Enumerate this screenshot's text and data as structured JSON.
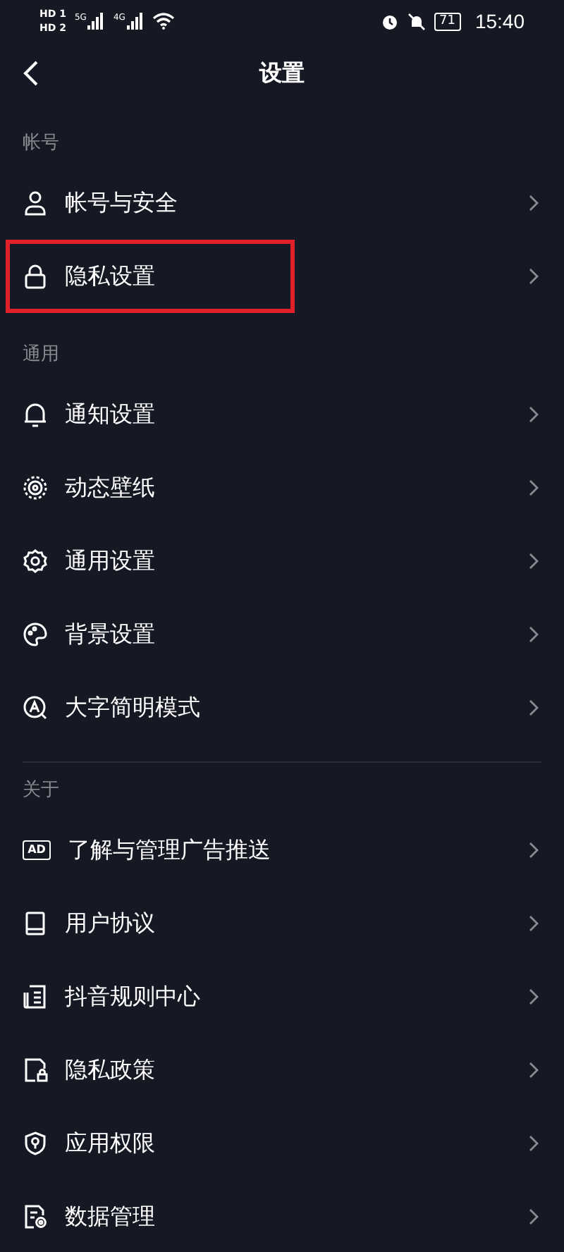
{
  "status_bar": {
    "sims": [
      {
        "label": "HD",
        "slot": "1"
      },
      {
        "label": "HD",
        "slot": "2"
      }
    ],
    "networks": [
      "5G",
      "4G"
    ],
    "battery": "71",
    "time": "15:40"
  },
  "header": {
    "title": "设置"
  },
  "sections": [
    {
      "title": "帐号",
      "divider": false,
      "items": [
        {
          "kind": "person",
          "label": "帐号与安全",
          "highlighted": false
        },
        {
          "kind": "lock",
          "label": "隐私设置",
          "highlighted": true
        }
      ]
    },
    {
      "title": "通用",
      "divider": false,
      "items": [
        {
          "kind": "bell",
          "label": "通知设置",
          "highlighted": false
        },
        {
          "kind": "wallpaper",
          "label": "动态壁纸",
          "highlighted": false
        },
        {
          "kind": "gear",
          "label": "通用设置",
          "highlighted": false
        },
        {
          "kind": "palette",
          "label": "背景设置",
          "highlighted": false
        },
        {
          "kind": "bigtext",
          "label": "大字简明模式",
          "highlighted": false
        }
      ]
    },
    {
      "title": "关于",
      "divider": true,
      "items": [
        {
          "kind": "ad",
          "icon_text": "AD",
          "label": "了解与管理广告推送",
          "highlighted": false
        },
        {
          "kind": "book",
          "label": "用户协议",
          "highlighted": false
        },
        {
          "kind": "document",
          "label": "抖音规则中心",
          "highlighted": false
        },
        {
          "kind": "filelock",
          "label": "隐私政策",
          "highlighted": false
        },
        {
          "kind": "shield",
          "label": "应用权限",
          "highlighted": false
        },
        {
          "kind": "datafile",
          "label": "数据管理",
          "highlighted": false
        }
      ]
    }
  ]
}
